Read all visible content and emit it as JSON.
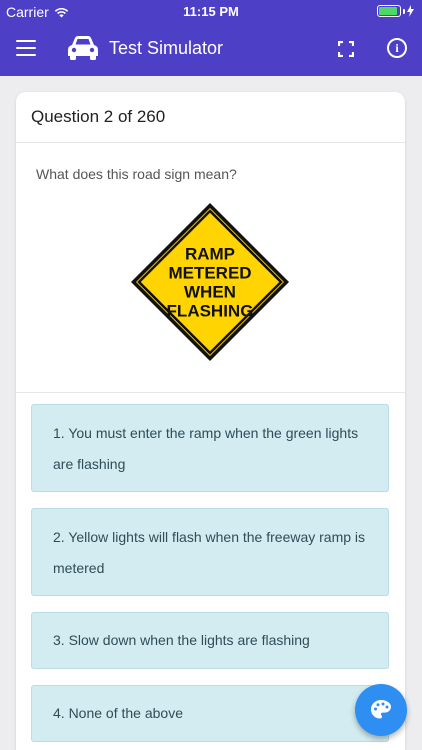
{
  "status_bar": {
    "carrier": "Carrier",
    "time": "11:15 PM",
    "battery_percent": 90
  },
  "app_bar": {
    "title": "Test Simulator"
  },
  "question": {
    "header": "Question 2 of 260",
    "prompt": "What does this road sign mean?",
    "sign_text": "RAMP\nMETERED\nWHEN\nFLASHING"
  },
  "options": [
    {
      "label": "1. You must enter the ramp when the green lights are flashing"
    },
    {
      "label": "2. Yellow lights will flash when the freeway ramp is metered"
    },
    {
      "label": "3. Slow down when the lights are flashing"
    },
    {
      "label": "4. None of the above"
    }
  ],
  "colors": {
    "primary": "#4e3fc7",
    "option_bg": "#d2ecf1",
    "fab": "#2e8ef2",
    "sign_yellow": "#ffd400"
  }
}
